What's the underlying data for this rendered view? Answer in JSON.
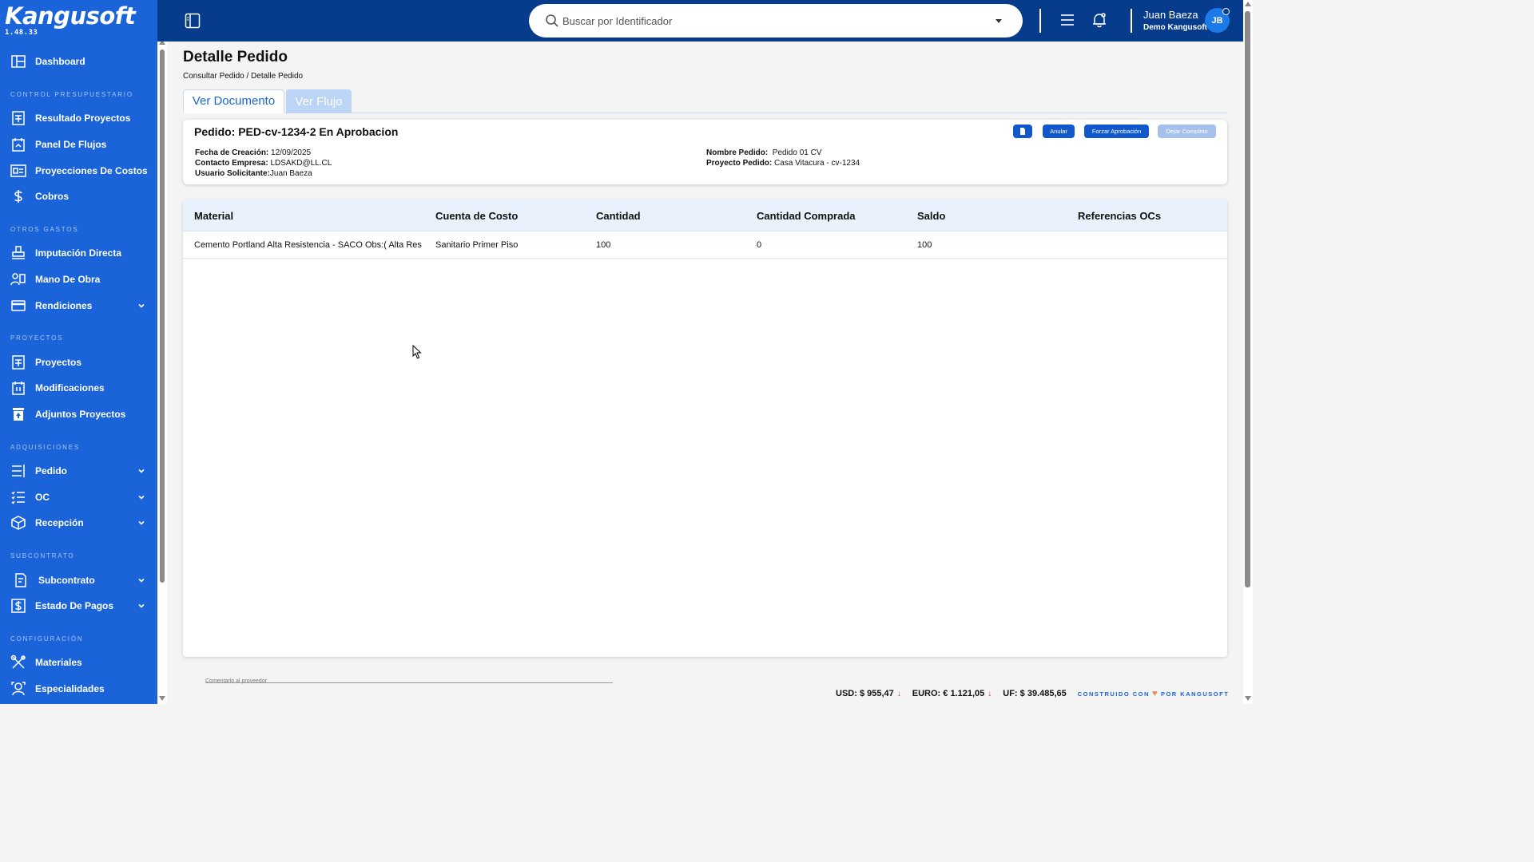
{
  "app": {
    "logo": "Kangusoft",
    "version": "1.48.33"
  },
  "sidebar": {
    "dashboard": "Dashboard",
    "sections": {
      "control": "CONTROL PRESUPUESTARIO",
      "otros": "OTROS GASTOS",
      "proyectos": "PROYECTOS",
      "adquisiciones": "ADQUISICIONES",
      "subcontrato": "SUBCONTRATO",
      "configuracion": "CONFIGURACIÓN"
    },
    "items": {
      "resultado": "Resultado Proyectos",
      "panel": "Panel De Flujos",
      "proyecciones": "Proyecciones De Costos",
      "cobros": "Cobros",
      "imputacion": "Imputación Directa",
      "mano": "Mano De Obra",
      "rendiciones": "Rendiciones",
      "proyectos": "Proyectos",
      "modificaciones": "Modificaciones",
      "adjuntos": "Adjuntos Proyectos",
      "pedido": "Pedido",
      "oc": "OC",
      "recepcion": "Recepción",
      "subcontrato": "Subcontrato",
      "estado": "Estado De Pagos",
      "materiales": "Materiales",
      "especialidades": "Especialidades"
    },
    "icons": [
      "dashboard-icon",
      "report-icon",
      "flow-panel-icon",
      "projection-icon",
      "dollar-icon",
      "stamp-icon",
      "workers-icon",
      "card-icon",
      "projects-icon",
      "modifications-icon",
      "attachments-icon",
      "order-list-icon",
      "checklist-icon",
      "package-icon",
      "contract-icon",
      "payment-icon",
      "tools-icon",
      "specialist-icon"
    ]
  },
  "topbar": {
    "search_placeholder": "Buscar por Identificador",
    "user_name": "Juan Baeza",
    "user_company": "Demo Kangusoft",
    "avatar_initials": "JB"
  },
  "page": {
    "title": "Detalle Pedido",
    "breadcrumb": "Consultar Pedido / Detalle Pedido",
    "tabs": [
      "Ver Documento",
      "Ver Flujo"
    ]
  },
  "card": {
    "title": "Pedido: PED-cv-1234-2 En Aprobacion",
    "buttons": {
      "anular": "Anular",
      "forzar": "Forzar Aprobación",
      "dejar": "Dejar Completo"
    },
    "fields": {
      "fecha_label": "Fecha de Creación:",
      "fecha_value": "12/09/2025",
      "contacto_label": "Contacto Empresa:",
      "contacto_value": "LDSAKD@LL.CL",
      "usuario_label": "Usuario Solicitante:",
      "usuario_value": "Juan Baeza",
      "nombre_label": "Nombre Pedido:",
      "nombre_value": "Pedido 01 CV",
      "proyecto_label": "Proyecto Pedido:",
      "proyecto_value": "Casa Vitacura - cv-1234"
    }
  },
  "table": {
    "columns": [
      "Material",
      "Cuenta de Costo",
      "Cantidad",
      "Cantidad Comprada",
      "Saldo",
      "Referencias OCs"
    ],
    "rows": [
      [
        "Cemento Portland Alta Resistencia - SACO Obs:( Alta Res",
        "Sanitario Primer Piso",
        "100",
        "0",
        "100",
        ""
      ]
    ]
  },
  "comment_label": "Comentario al proveedor",
  "footer": {
    "usd": "USD: $ 955,47",
    "euro": "EURO: € 1.121,05",
    "uf": "UF: $ 39.485,65",
    "built_prefix": "CONSTRUIDO CON",
    "built_suffix": "POR KANGUSOFT"
  },
  "colors": {
    "sidebar": "#1a63d9",
    "topbar": "#073c8d",
    "primary_button": "#1158cc",
    "disabled_button": "#a5c1eb"
  }
}
